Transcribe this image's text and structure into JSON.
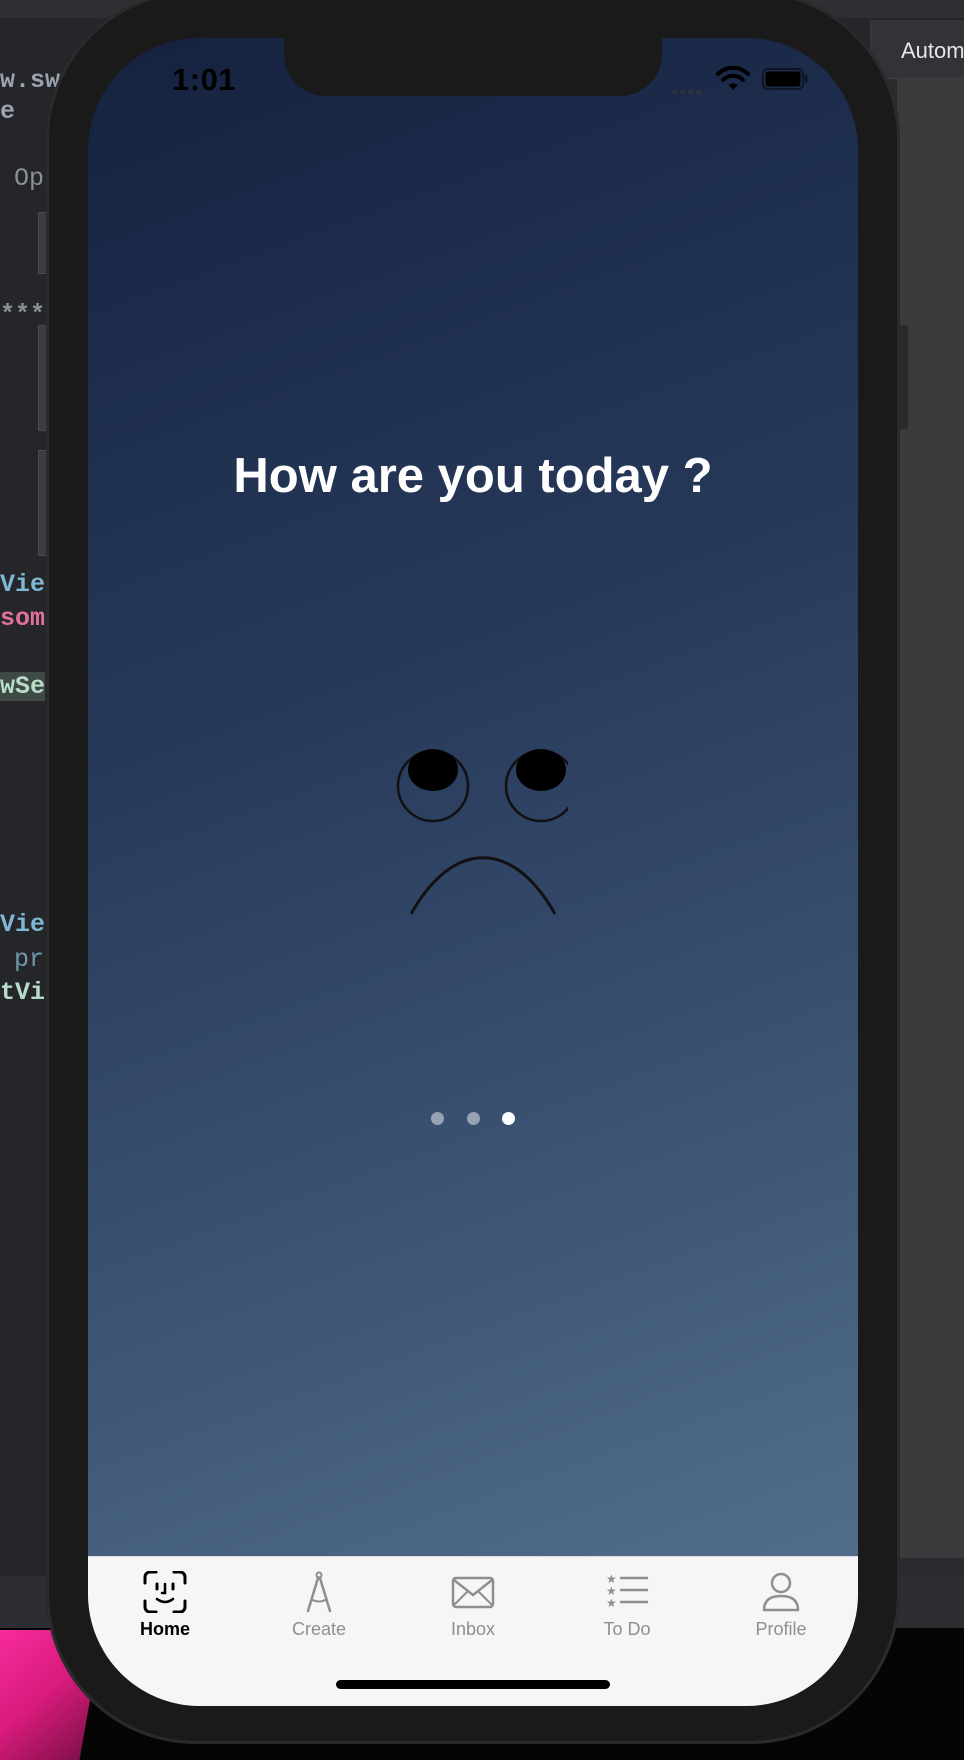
{
  "status_bar": {
    "time": "1:01"
  },
  "backdrop": {
    "inspector_title": "Autom",
    "code_fragments": [
      "w.swi",
      "e",
      "Op",
      "***",
      "Vie",
      "som",
      "wSe",
      "Vie",
      "pr",
      "tVi"
    ]
  },
  "screen": {
    "question": "How are you today ?",
    "page_indicator": {
      "count": 3,
      "current": 3
    }
  },
  "tabbar": {
    "selected": "Home",
    "tabs": [
      {
        "label": "Home",
        "icon": "face-id-icon"
      },
      {
        "label": "Create",
        "icon": "compass-icon"
      },
      {
        "label": "Inbox",
        "icon": "envelope-icon"
      },
      {
        "label": "To Do",
        "icon": "list-star-icon"
      },
      {
        "label": "Profile",
        "icon": "person-icon"
      }
    ]
  }
}
